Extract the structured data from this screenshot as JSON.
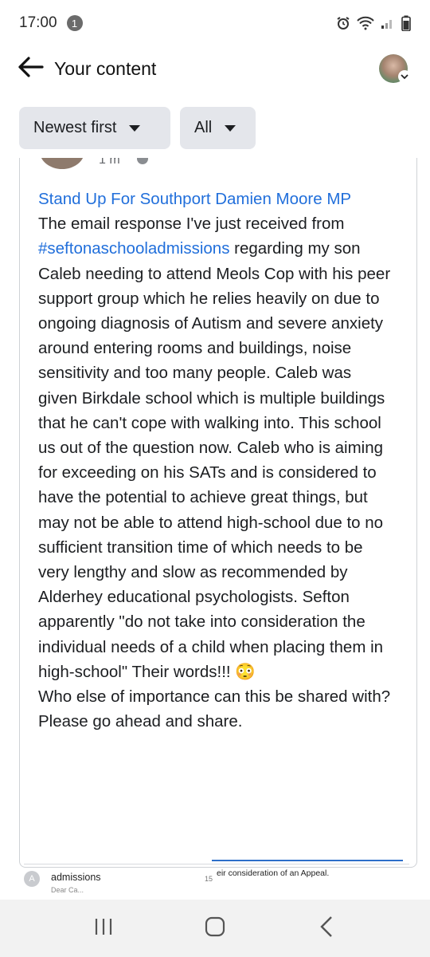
{
  "status_bar": {
    "time": "17:00",
    "notification_count": "1"
  },
  "header": {
    "title": "Your content"
  },
  "filters": {
    "sort_label": "Newest first",
    "type_label": "All"
  },
  "post": {
    "time_partial": "1 m",
    "body_parts": [
      {
        "text": "Stand Up For Southport Damien Moore MP",
        "link": true
      },
      {
        "text": "The email response I've just received from ",
        "link": false
      },
      {
        "text": "#seftonaschooladmissions",
        "link": true
      },
      {
        "text": " regarding my son Caleb needing to attend Meols Cop with his peer support group which he relies heavily on due to ongoing diagnosis of Autism and severe anxiety around entering rooms and buildings, noise sensitivity and too many people. Caleb was given Birkdale school which is multiple buildings that he can't cope with walking into.  This school us out of the question now.  Caleb who is aiming for exceeding on his SATs and is considered to have the potential to achieve great things, but may not be able to attend high-school due to no sufficient transition time of which needs to be very lengthy and slow as recommended by Alderhey educational psychologists. Sefton apparently \"do not take into consideration the individual needs of a child when placing them in high-school\" Their words!!! 😳",
        "link": false
      },
      {
        "text": "Who else of importance can this be shared with? Please go ahead and share.",
        "link": false
      }
    ]
  },
  "attachment": {
    "avatar_letter": "A",
    "title": "admissions",
    "subtitle": "Dear Ca...",
    "page_number": "15",
    "snippet": "eir consideration of an Appeal."
  },
  "colors": {
    "link": "#216fdb",
    "filter_bg": "#e4e6eb",
    "nav_bg": "#f2f2f2"
  },
  "icons": {
    "back": "arrow-left-icon",
    "recents": "recents-icon",
    "home": "home-icon",
    "nav_back": "chevron-left-icon"
  }
}
